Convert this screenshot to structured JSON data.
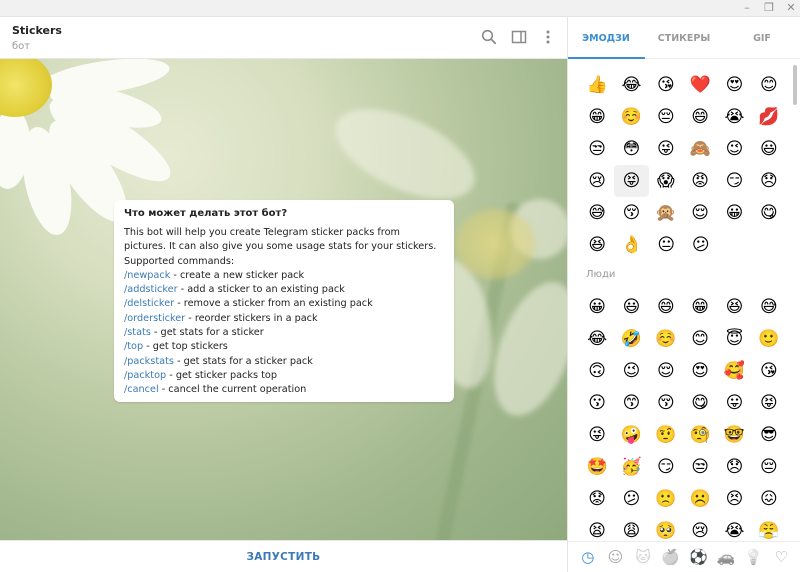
{
  "window": {
    "minimize_glyph": "–",
    "restore_glyph": "❐",
    "close_glyph": "✕"
  },
  "chat": {
    "title": "Stickers",
    "subtitle": "бот",
    "header_icons": [
      "search-icon",
      "sidebar-toggle-icon",
      "more-vertical-icon"
    ]
  },
  "message": {
    "title": "Что может делать этот бот?",
    "intro": "This bot will help you create Telegram sticker packs from pictures. It can also give you some usage stats for your stickers. Supported commands:",
    "commands": [
      {
        "cmd": "/newpack",
        "desc": " - create a new sticker pack"
      },
      {
        "cmd": "/addsticker",
        "desc": " - add a sticker to an existing pack"
      },
      {
        "cmd": "/delsticker",
        "desc": " - remove a sticker from an existing pack"
      },
      {
        "cmd": "/ordersticker",
        "desc": " - reorder stickers in a pack"
      },
      {
        "cmd": "/stats",
        "desc": " - get stats for a sticker"
      },
      {
        "cmd": "/top",
        "desc": " - get top stickers"
      },
      {
        "cmd": "/packstats",
        "desc": " - get stats for a sticker pack"
      },
      {
        "cmd": "/packtop",
        "desc": " - get sticker packs top"
      },
      {
        "cmd": "/cancel",
        "desc": " - cancel the current operation"
      }
    ],
    "link_color": "#3a7ab6"
  },
  "start_button": {
    "label": "ЗАПУСТИТЬ"
  },
  "panel": {
    "tabs": [
      {
        "label": "ЭМОДЗИ",
        "active": true
      },
      {
        "label": "СТИКЕРЫ",
        "active": false
      },
      {
        "label": "GIF",
        "active": false
      }
    ],
    "accent_color": "#3a8ed0",
    "recent_emoji": [
      [
        "👍",
        "😂",
        "😘",
        "❤️",
        "😍",
        "😊"
      ],
      [
        "😁",
        "☺️",
        "😔",
        "😄",
        "😭",
        "💋"
      ],
      [
        "😒",
        "😳",
        "😜",
        "🙈",
        "😉",
        "😃"
      ],
      [
        "😢",
        "😝",
        "😱",
        "😡",
        "😏",
        "😞"
      ],
      [
        "😅",
        "😚",
        "🙊",
        "😌",
        "😀",
        "😋"
      ],
      [
        "😆",
        "👌",
        "😐",
        "😕"
      ]
    ],
    "section_label": "Люди",
    "people_emoji": [
      [
        "😀",
        "😃",
        "😄",
        "😁",
        "😆",
        "😅"
      ],
      [
        "😂",
        "🤣",
        "☺️",
        "😊",
        "😇",
        "🙂"
      ],
      [
        "🙃",
        "😉",
        "😌",
        "😍",
        "🥰",
        "😘"
      ],
      [
        "😗",
        "😙",
        "😚",
        "😋",
        "😛",
        "😝"
      ],
      [
        "😜",
        "🤪",
        "🤨",
        "🧐",
        "🤓",
        "😎"
      ],
      [
        "🤩",
        "🥳",
        "😏",
        "😒",
        "😞",
        "😔"
      ],
      [
        "😟",
        "😕",
        "🙁",
        "☹️",
        "😣",
        "😖"
      ],
      [
        "😫",
        "😩",
        "🥺",
        "😢",
        "😭",
        "😤"
      ]
    ],
    "categories": [
      {
        "name": "recent-icon",
        "glyph": "◷",
        "active": true
      },
      {
        "name": "smile-icon",
        "glyph": "☺",
        "active": false
      },
      {
        "name": "cat-icon",
        "glyph": "🐱",
        "active": false
      },
      {
        "name": "food-icon",
        "glyph": "🍏",
        "active": false
      },
      {
        "name": "sport-icon",
        "glyph": "⚽",
        "active": false
      },
      {
        "name": "car-icon",
        "glyph": "🚗",
        "active": false
      },
      {
        "name": "lightbulb-icon",
        "glyph": "💡",
        "active": false
      },
      {
        "name": "heart-icon",
        "glyph": "♡",
        "active": false
      }
    ]
  }
}
